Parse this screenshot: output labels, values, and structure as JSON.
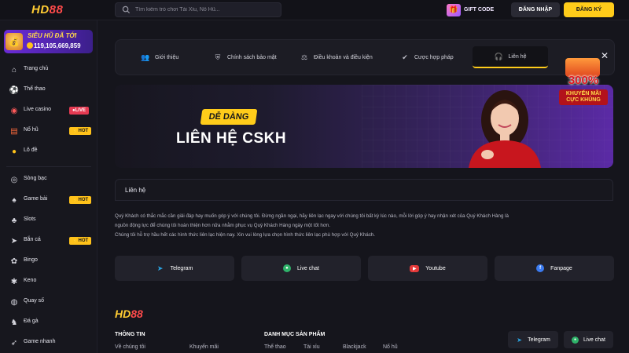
{
  "header": {
    "logo_hd": "HD",
    "logo_88": "88",
    "search_placeholder": "Tìm kiếm trò chơi Tài Xỉu, Nổ Hũ...",
    "gift_code": "GIFT CODE",
    "login": "ĐĂNG NHẬP",
    "register": "ĐĂNG KÝ"
  },
  "jackpot": {
    "title": "SIÊU HŨ ĐÃ TỚI",
    "value": "119,105,669,859"
  },
  "sidebar": {
    "items": [
      {
        "label": "Trang chủ",
        "icon": "home-icon"
      },
      {
        "label": "Thể thao",
        "icon": "soccer-ball-icon"
      },
      {
        "label": "Live casino",
        "icon": "roulette-icon",
        "badge": "LIVE"
      },
      {
        "label": "Nổ hũ",
        "icon": "slot-icon",
        "badge": "HOT"
      },
      {
        "label": "Lô đề",
        "icon": "lottery-icon"
      },
      {
        "label": "Sòng bạc",
        "icon": "casino-chip-icon"
      },
      {
        "label": "Game bài",
        "icon": "cards-icon",
        "badge": "HOT"
      },
      {
        "label": "Slots",
        "icon": "cherry-icon"
      },
      {
        "label": "Bắn cá",
        "icon": "fish-icon",
        "badge": "HOT"
      },
      {
        "label": "Bingo",
        "icon": "bingo-icon"
      },
      {
        "label": "Keno",
        "icon": "keno-icon"
      },
      {
        "label": "Quay số",
        "icon": "wheel-icon"
      },
      {
        "label": "Đá gà",
        "icon": "rooster-icon"
      },
      {
        "label": "Game nhanh",
        "icon": "rocket-icon"
      }
    ]
  },
  "tabs": [
    {
      "label": "Giới thiệu",
      "icon": "users-icon"
    },
    {
      "label": "Chính sách bảo mật",
      "icon": "shield-icon"
    },
    {
      "label": "Điều khoản và điều kiện",
      "icon": "gavel-icon"
    },
    {
      "label": "Cược hợp pháp",
      "icon": "check-circle-icon"
    },
    {
      "label": "Liên hệ",
      "icon": "headset-icon",
      "active": true
    }
  ],
  "banner": {
    "subtitle": "DỄ DÀNG",
    "title": "LIÊN HỆ CSKH",
    "promo_percent": "300%",
    "promo_text_1": "KHUYẾN MÃI",
    "promo_text_2": "CỰC KHỦNG"
  },
  "contact": {
    "heading": "Liên hệ",
    "line1": "Quý Khách có thắc mắc cần giải đáp hay muốn góp ý với chúng tôi. Đừng ngần ngại, hãy liên lạc ngay với chúng tôi bất kỳ lúc nào, mỗi lời góp ý hay nhận xét của Quý Khách Hàng là",
    "line2": "nguồn động lực để chúng tôi hoàn thiện hơn nữa nhằm phục vụ Quý Khách Hàng ngày một tốt hơn.",
    "line3": "Chúng tôi hỗ trợ hầu hết các hình thức liên lạc hiện nay. Xin vui lòng lựa chọn hình thức liên lạc phù hợp với Quý Khách.",
    "buttons": [
      {
        "label": "Telegram",
        "color": "#2aa3e0"
      },
      {
        "label": "Live chat",
        "color": "#2fb36a"
      },
      {
        "label": "Youtube",
        "color": "#e53a3a"
      },
      {
        "label": "Fanpage",
        "color": "#3b7bf0"
      }
    ]
  },
  "footer": {
    "info_heading": "THÔNG TIN",
    "info_links": [
      "Về chúng tôi",
      "Khuyến mãi"
    ],
    "products_heading": "DANH MỤC SẢN PHẨM",
    "product_links": [
      "Thể thao",
      "Tài xỉu",
      "Blackjack",
      "Nổ hũ"
    ],
    "telegram": "Telegram",
    "live_chat": "Live chat"
  }
}
